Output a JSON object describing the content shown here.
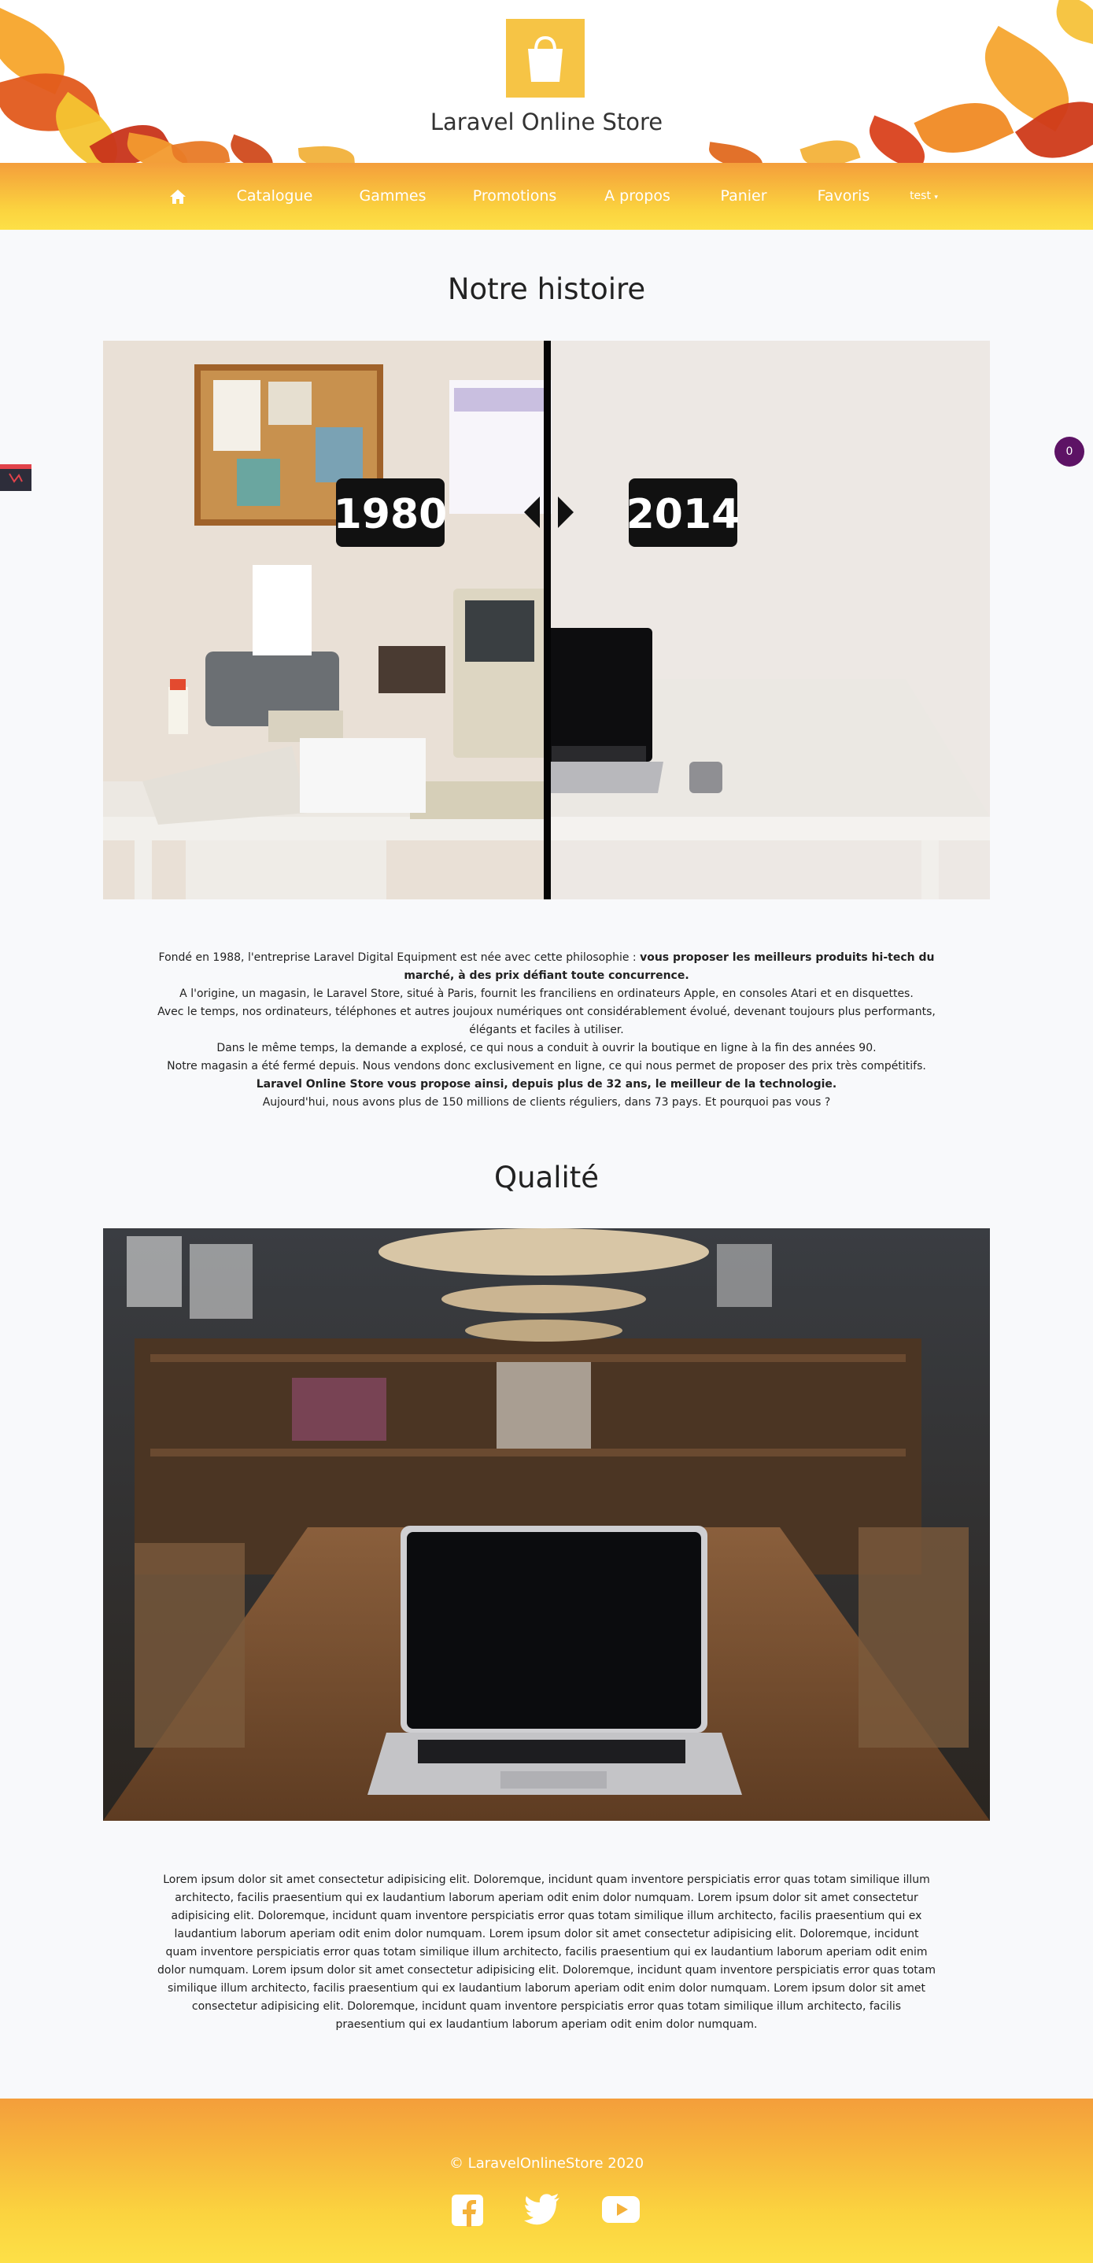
{
  "site": {
    "title": "Laravel Online Store"
  },
  "nav": {
    "items": [
      {
        "label": "Catalogue"
      },
      {
        "label": "Gammes"
      },
      {
        "label": "Promotions"
      },
      {
        "label": "A propos"
      },
      {
        "label": "Panier"
      },
      {
        "label": "Favoris"
      }
    ],
    "user_menu": "test"
  },
  "cart_badge": {
    "count": "0"
  },
  "history": {
    "title": "Notre histoire",
    "image_year_left": "1980",
    "image_year_right": "2014",
    "lines": [
      {
        "pre": "Fondé en 1988, l'entreprise Laravel Digital Equipment est née avec cette philosophie : ",
        "bold": "vous proposer les meilleurs produits hi-tech du marché, à des prix défiant toute concurrence."
      },
      {
        "pre": "A l'origine, un magasin, le Laravel Store, situé à Paris, fournit les franciliens en ordinateurs Apple, en consoles Atari et en disquettes.",
        "bold": ""
      },
      {
        "pre": "Avec le temps, nos ordinateurs, téléphones et autres joujoux numériques ont considérablement évolué, devenant toujours plus performants, élégants et faciles à utiliser.",
        "bold": ""
      },
      {
        "pre": "Dans le même temps, la demande a explosé, ce qui nous a conduit à ouvrir la boutique en ligne à la fin des années 90.",
        "bold": ""
      },
      {
        "pre": "Notre magasin a été fermé depuis. Nous vendons donc exclusivement en ligne, ce qui nous permet de proposer des prix très compétitifs.",
        "bold": ""
      },
      {
        "pre": "",
        "bold": "Laravel Online Store vous propose ainsi, depuis plus de 32 ans, le meilleur de la technologie."
      },
      {
        "pre": "Aujourd'hui, nous avons plus de 150 millions de clients réguliers, dans 73 pays. Et pourquoi pas vous ?",
        "bold": ""
      }
    ]
  },
  "quality": {
    "title": "Qualité",
    "text": "Lorem ipsum dolor sit amet consectetur adipisicing elit. Doloremque, incidunt quam inventore perspiciatis error quas totam similique illum architecto, facilis praesentium qui ex laudantium laborum aperiam odit enim dolor numquam. Lorem ipsum dolor sit amet consectetur adipisicing elit. Doloremque, incidunt quam inventore perspiciatis error quas totam similique illum architecto, facilis praesentium qui ex laudantium laborum aperiam odit enim dolor numquam. Lorem ipsum dolor sit amet consectetur adipisicing elit. Doloremque, incidunt quam inventore perspiciatis error quas totam similique illum architecto, facilis praesentium qui ex laudantium laborum aperiam odit enim dolor numquam. Lorem ipsum dolor sit amet consectetur adipisicing elit. Doloremque, incidunt quam inventore perspiciatis error quas totam similique illum architecto, facilis praesentium qui ex laudantium laborum aperiam odit enim dolor numquam. Lorem ipsum dolor sit amet consectetur adipisicing elit. Doloremque, incidunt quam inventore perspiciatis error quas totam similique illum architecto, facilis praesentium qui ex laudantium laborum aperiam odit enim dolor numquam."
  },
  "footer": {
    "copyright": "© LaravelOnlineStore 2020"
  },
  "icons": [
    "shopping-bag-icon",
    "home-icon",
    "caret-down-icon",
    "facebook-icon",
    "twitter-icon",
    "youtube-icon",
    "laravel-debugbar-icon"
  ],
  "colors": {
    "accent": "#f6c445",
    "nav_top": "#f49e3b",
    "nav_bottom": "#fde047",
    "badge": "#5d1365"
  }
}
